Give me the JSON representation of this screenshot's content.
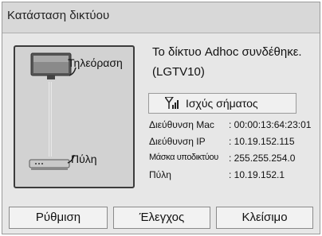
{
  "dialog": {
    "title": "Κατάσταση δικτύου"
  },
  "diagram": {
    "tv_label": "Τηλεόραση",
    "gateway_label": "Πύλη",
    "tv_icon": "tv-icon",
    "gateway_icon": "router-icon"
  },
  "status": {
    "line1": "Το δίκτυο Adhoc συνδέθηκε.",
    "line2": "(LGTV10)"
  },
  "signal_button": {
    "label": "Ισχύς σήματος",
    "icon": "signal-bars-icon"
  },
  "info": [
    {
      "key": "Διεύθυνση Mac",
      "value": ": 00:00:13:64:23:01"
    },
    {
      "key": "Διεύθυνση IP",
      "value": ": 10.19.152.115"
    },
    {
      "key": "Μάσκα υποδικτύου",
      "value": ": 255.255.254.0"
    },
    {
      "key": "Πύλη",
      "value": ": 10.19.152.1"
    }
  ],
  "buttons": {
    "settings": "Ρύθμιση",
    "check": "Έλεγχος",
    "close": "Κλείσιμο"
  }
}
